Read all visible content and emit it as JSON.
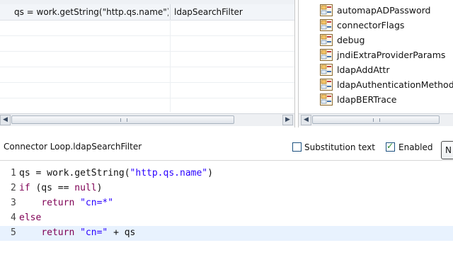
{
  "mapping_table": {
    "rows": [
      {
        "expression": "qs = work.getString(\"http.qs.name\");",
        "attribute": "ldapSearchFilter"
      }
    ]
  },
  "parameter_list": {
    "items": [
      "automapADPassword",
      "connectorFlags",
      "debug",
      "jndiExtraProviderParams",
      "ldapAddAttr",
      "ldapAuthenticationMethod",
      "ldapBERTrace"
    ]
  },
  "editor": {
    "title": "Connector Loop.ldapSearchFilter",
    "substitution_text_label": "Substitution text",
    "substitution_text_checked": false,
    "enabled_label": "Enabled",
    "enabled_checked": true,
    "next_button_label": "N",
    "lines": [
      {
        "number": "1",
        "text": "qs = work.getString(\"http.qs.name\")"
      },
      {
        "number": "2",
        "text": "if (qs == null)"
      },
      {
        "number": "3",
        "text": "    return \"cn=*\""
      },
      {
        "number": "4",
        "text": "else"
      },
      {
        "number": "5",
        "text": "    return \"cn=\" + qs"
      }
    ]
  },
  "icons": {
    "scroll_left": "arrow-left-icon",
    "scroll_right": "arrow-right-icon",
    "list_item": "parameter-icon"
  }
}
